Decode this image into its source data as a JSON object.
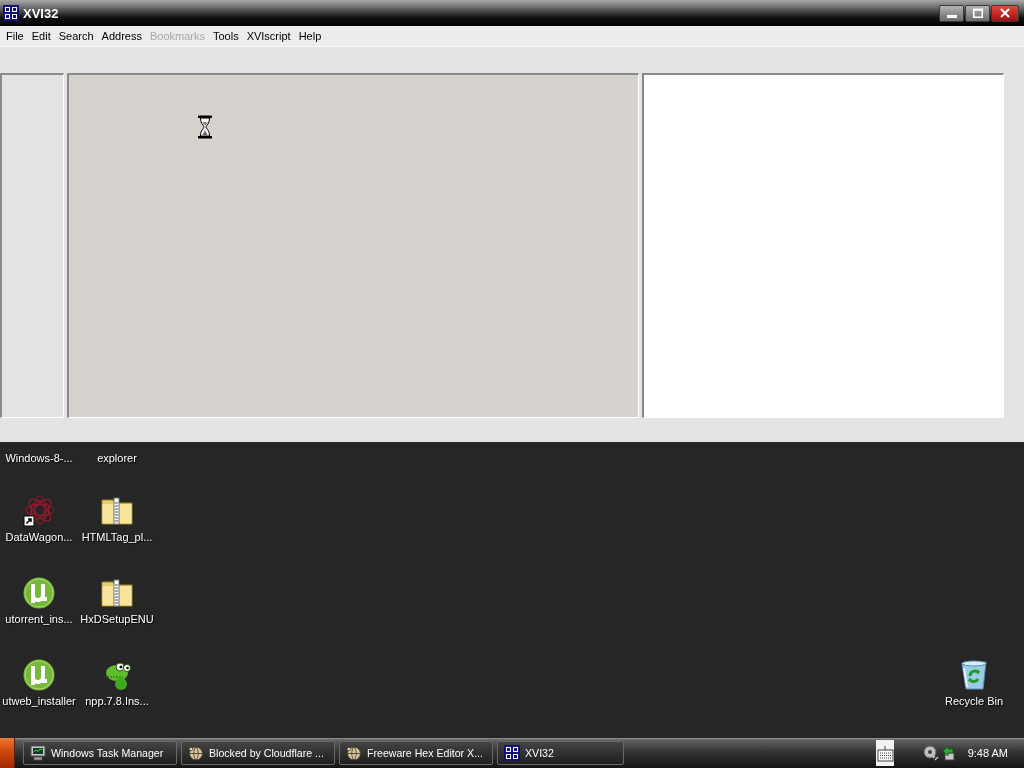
{
  "window": {
    "title": "XVI32",
    "menu": [
      {
        "label": "File",
        "disabled": false
      },
      {
        "label": "Edit",
        "disabled": false
      },
      {
        "label": "Search",
        "disabled": false
      },
      {
        "label": "Address",
        "disabled": false
      },
      {
        "label": "Bookmarks",
        "disabled": true
      },
      {
        "label": "Tools",
        "disabled": false
      },
      {
        "label": "XVIscript",
        "disabled": false
      },
      {
        "label": "Help",
        "disabled": false
      }
    ]
  },
  "desktop": {
    "icons": [
      {
        "label": "Windows-8-...",
        "kind": "covered"
      },
      {
        "label": "explorer",
        "kind": "covered"
      },
      {
        "label": "DataWagon...",
        "kind": "spiral"
      },
      {
        "label": "HTMLTag_pl...",
        "kind": "zip"
      },
      {
        "label": "utorrent_ins...",
        "kind": "mu"
      },
      {
        "label": "HxDSetupENU",
        "kind": "zip"
      },
      {
        "label": "utweb_installer",
        "kind": "mu"
      },
      {
        "label": "npp.7.8.Ins...",
        "kind": "lizard"
      }
    ],
    "recycle_bin": {
      "label": "Recycle Bin"
    }
  },
  "taskbar": {
    "tasks": [
      {
        "label": "Windows Task Manager",
        "kind": "monitor"
      },
      {
        "label": "Blocked by Cloudflare ...",
        "kind": "browser"
      },
      {
        "label": "Freeware Hex Editor X...",
        "kind": "browser"
      },
      {
        "label": "XVI32",
        "kind": "hex"
      }
    ],
    "clock": "9:48 AM"
  }
}
